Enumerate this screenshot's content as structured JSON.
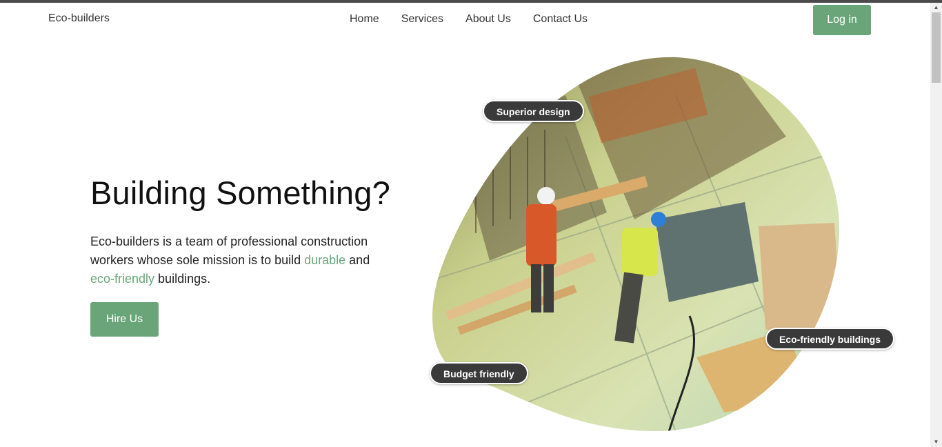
{
  "brand": "Eco-builders",
  "nav": {
    "items": [
      "Home",
      "Services",
      "About Us",
      "Contact Us"
    ]
  },
  "header": {
    "login_label": "Log in"
  },
  "hero": {
    "title": "Building Something?",
    "desc_part1": "Eco-builders is a team of professional construction workers whose sole mission is to build ",
    "highlight1": "durable",
    "desc_part2": " and ",
    "highlight2": "eco-friendly",
    "desc_part3": " buildings.",
    "cta_label": "Hire Us"
  },
  "badges": [
    "Superior design",
    "Eco-friendly buildings",
    "Budget friendly"
  ],
  "colors": {
    "accent": "#6aa57a",
    "badge_bg": "#3a3a3a",
    "topbar": "#4a4a4a"
  }
}
